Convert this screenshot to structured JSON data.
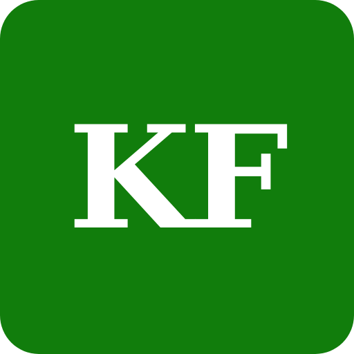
{
  "icon": {
    "monogram": "KF",
    "background_color": "#117d0c",
    "text_color": "#ffffff"
  }
}
